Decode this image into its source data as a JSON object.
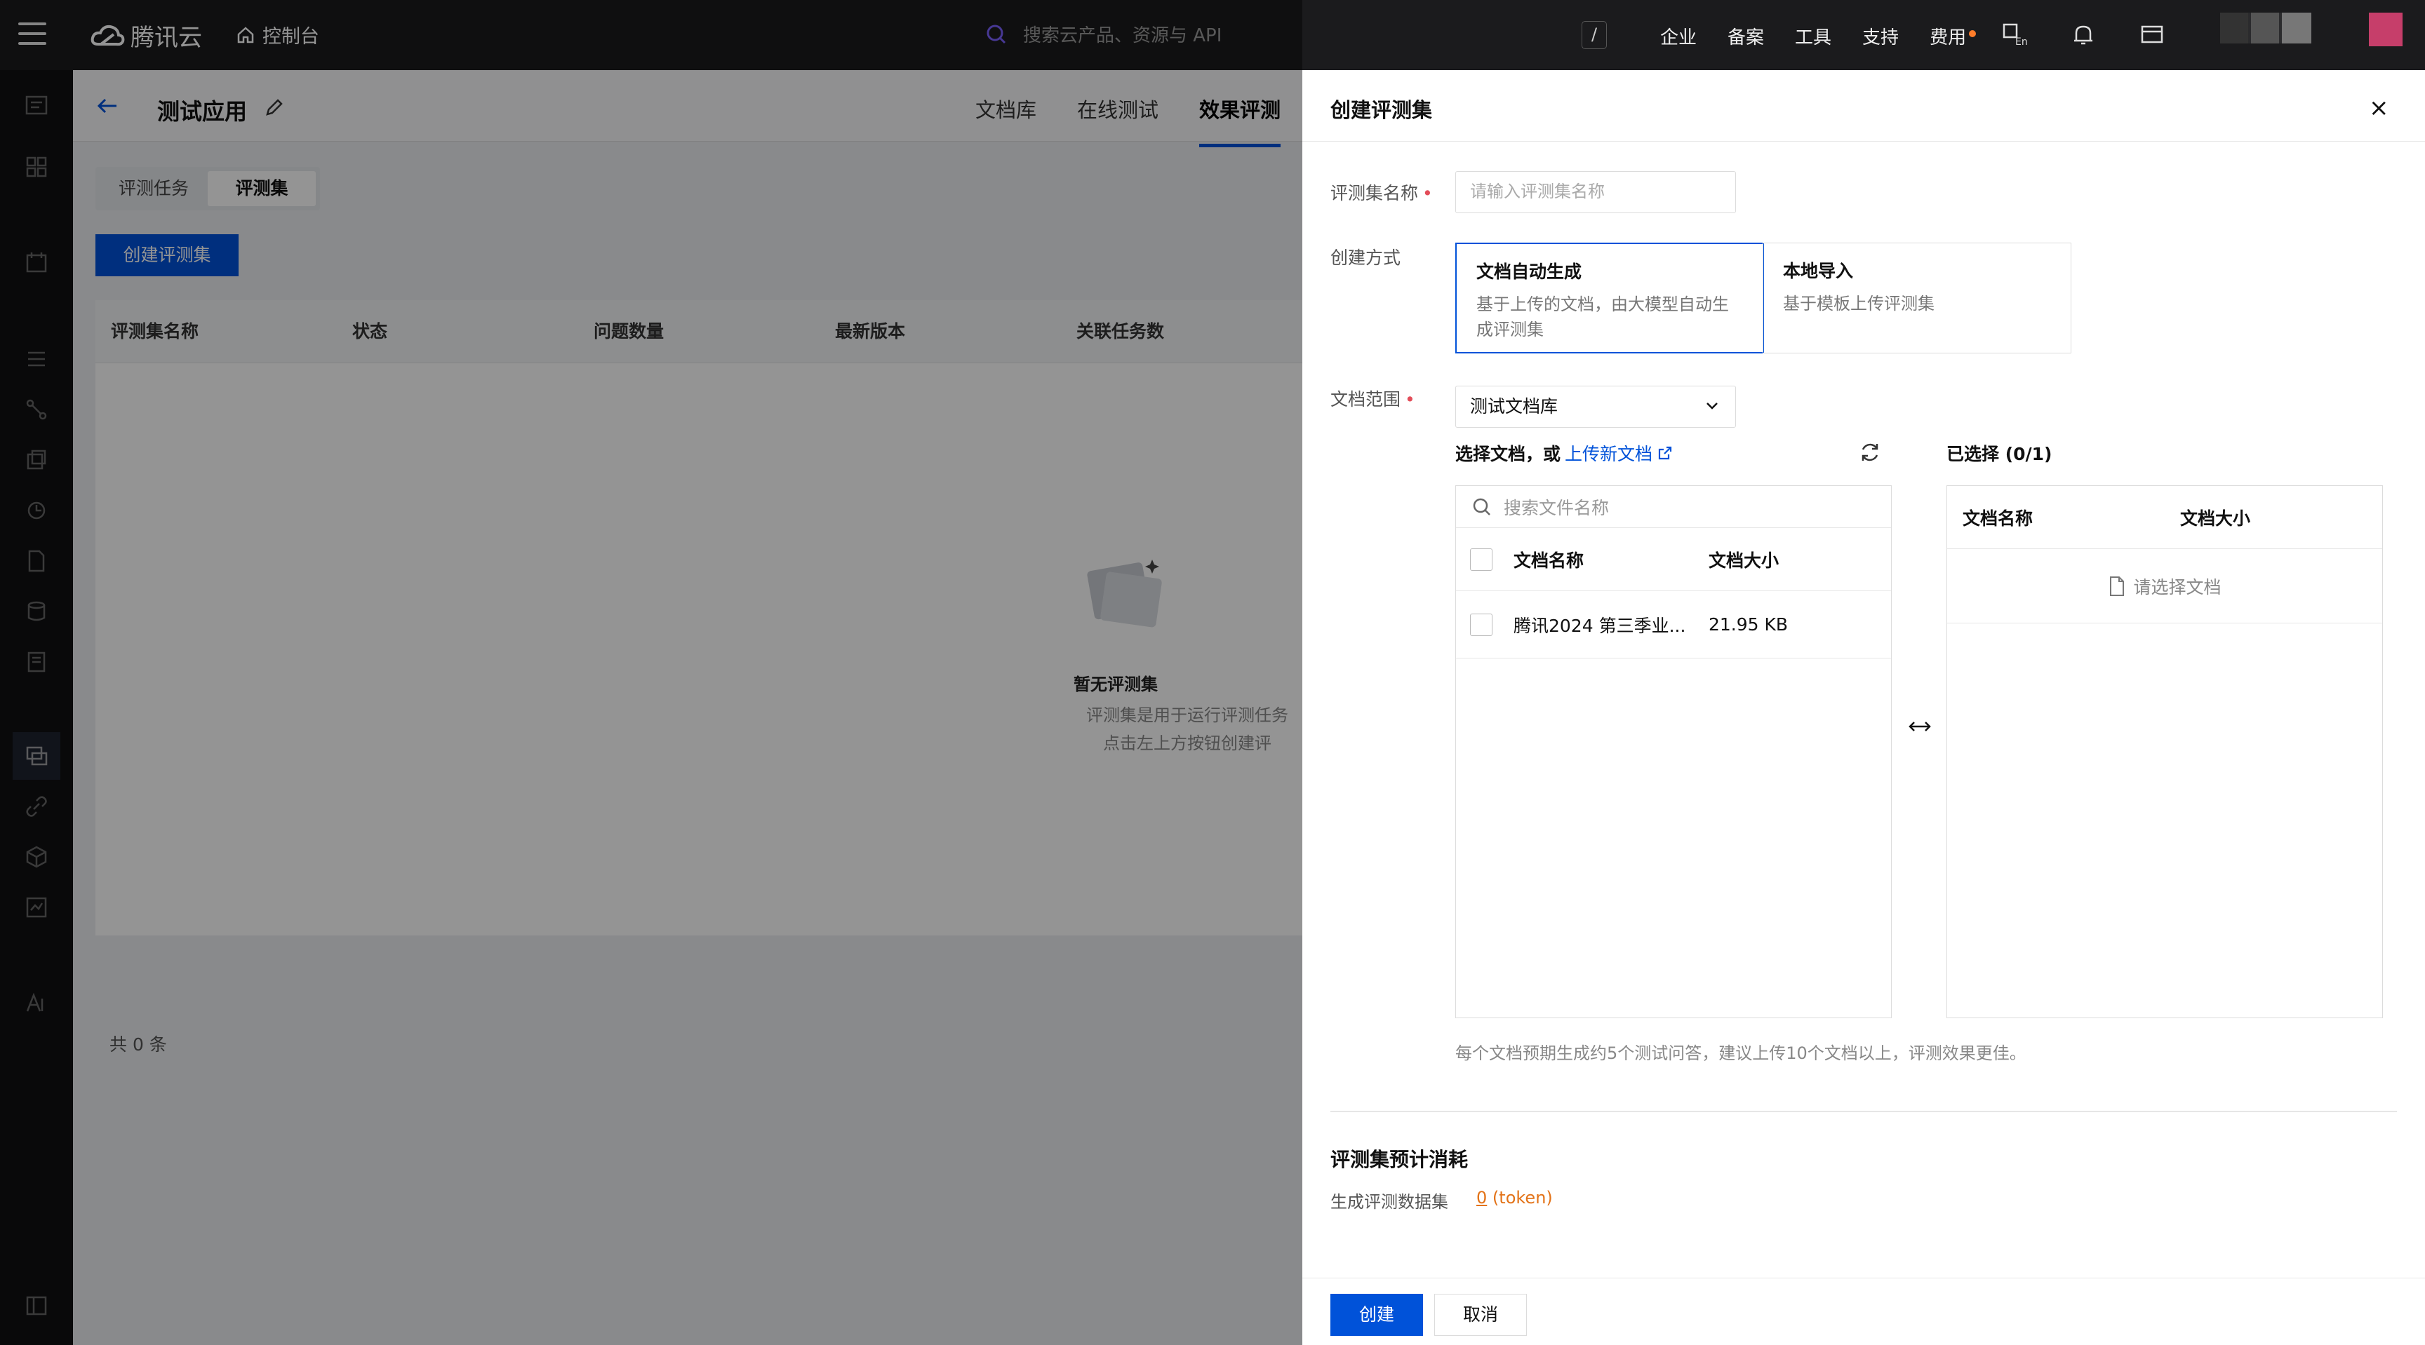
{
  "topbar": {
    "brand": "腾讯云",
    "console": "控制台",
    "search_placeholder": "搜索云产品、资源与 API",
    "shortcut": "/",
    "nav": [
      "企业",
      "备案",
      "工具",
      "支持",
      "费用"
    ]
  },
  "app": {
    "title": "测试应用",
    "tabs": [
      "文档库",
      "在线测试",
      "效果评测"
    ],
    "active_tab": "效果评测",
    "segments": [
      "评测任务",
      "评测集"
    ],
    "create_button": "创建评测集",
    "columns": [
      "评测集名称",
      "状态",
      "问题数量",
      "最新版本",
      "关联任务数"
    ],
    "empty_title": "暂无评测集",
    "empty_desc_1": "评测集是用于运行评测任务",
    "empty_desc_2": "点击左上方按钮创建评",
    "total": "共 0 条"
  },
  "drawer": {
    "title": "创建评测集",
    "close": "×",
    "name_label": "评测集名称",
    "name_placeholder": "请输入评测集名称",
    "method_label": "创建方式",
    "methods": [
      {
        "title": "文档自动生成",
        "desc": "基于上传的文档，由大模型自动生成评测集",
        "selected": true
      },
      {
        "title": "本地导入",
        "desc": "基于模板上传评测集",
        "selected": false
      }
    ],
    "scope_label": "文档范围",
    "scope_value": "测试文档库",
    "pick_label": "选择文档，或",
    "upload_link": "上传新文档",
    "selected_label": "已选择 (0/1)",
    "file_search_placeholder": "搜索文件名称",
    "col_name": "文档名称",
    "col_size": "文档大小",
    "files": [
      {
        "name": "腾讯2024 第三季业...",
        "size": "21.95 KB"
      }
    ],
    "empty_selected": "请选择文档",
    "hint": "每个文档预期生成约5个测试问答，建议上传10个文档以上，评测效果更佳。",
    "cost_title": "评测集预计消耗",
    "cost_label": "生成评测数据集",
    "cost_value": "0",
    "cost_unit": "(token)",
    "submit": "创建",
    "cancel": "取消"
  },
  "colors": {
    "accent": "#0052d9",
    "warning": "#e37318",
    "required": "#e34d59"
  }
}
